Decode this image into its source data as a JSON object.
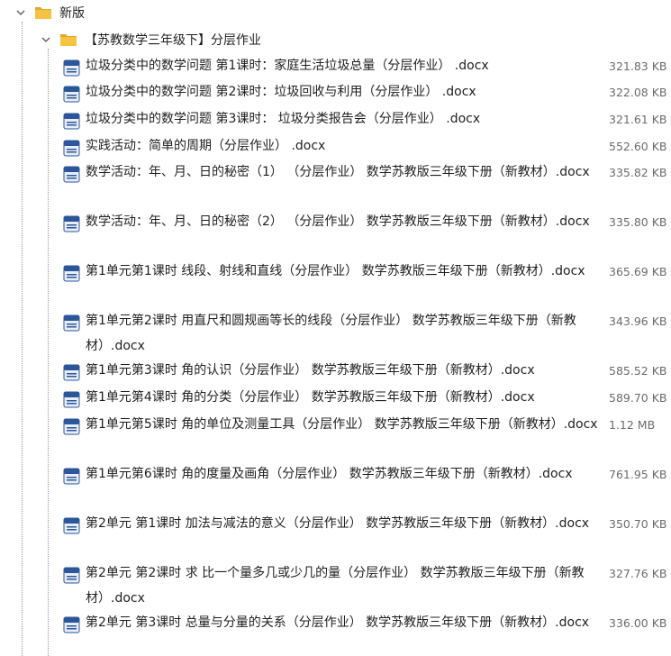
{
  "root_folder": {
    "name": "新版"
  },
  "sub_folder": {
    "name": "【苏教数学三年级下】分层作业"
  },
  "files": [
    {
      "name": "垃圾分类中的数学问题 第1课时：家庭生活垃圾总量（分层作业） .docx",
      "size": "321.83 KB"
    },
    {
      "name": "垃圾分类中的数学问题 第2课时：垃圾回收与利用（分层作业） .docx",
      "size": "322.08 KB"
    },
    {
      "name": "垃圾分类中的数学问题 第3课时： 垃圾分类报告会（分层作业） .docx",
      "size": "321.61 KB"
    },
    {
      "name": "实践活动：简单的周期（分层作业） .docx",
      "size": "552.60 KB"
    },
    {
      "name": "数学活动：年、月、日的秘密（1） （分层作业） 数学苏教版三年级下册（新教材）.docx",
      "size": "335.82 KB"
    },
    {
      "name": "数学活动：年、月、日的秘密（2） （分层作业） 数学苏教版三年级下册（新教材）.docx",
      "size": "335.80 KB"
    },
    {
      "name": "第1单元第1课时 线段、射线和直线（分层作业） 数学苏教版三年级下册（新教材）.docx",
      "size": "365.69 KB"
    },
    {
      "name": "第1单元第2课时 用直尺和圆规画等长的线段（分层作业） 数学苏教版三年级下册（新教材）.docx",
      "size": "343.96 KB"
    },
    {
      "name": "第1单元第3课时 角的认识（分层作业） 数学苏教版三年级下册（新教材）.docx",
      "size": "585.52 KB"
    },
    {
      "name": "第1单元第4课时 角的分类（分层作业） 数学苏教版三年级下册（新教材）.docx",
      "size": "589.70 KB"
    },
    {
      "name": "第1单元第5课时 角的单位及测量工具（分层作业） 数学苏教版三年级下册（新教材）.docx",
      "size": "1.12 MB"
    },
    {
      "name": "第1单元第6课时 角的度量及画角（分层作业） 数学苏教版三年级下册（新教材）.docx",
      "size": "761.95 KB"
    },
    {
      "name": "第2单元 第1课时 加法与减法的意义（分层作业） 数学苏教版三年级下册（新教材）.docx",
      "size": "350.70 KB"
    },
    {
      "name": "第2单元 第2课时 求 比一个量多几或少几的量（分层作业） 数学苏教版三年级下册（新教材）.docx",
      "size": "327.76 KB"
    },
    {
      "name": "第2单元 第3课时 总量与分量的关系（分层作业） 数学苏教版三年级下册（新教材）.docx",
      "size": "336.00 KB"
    }
  ],
  "colors": {
    "folder_yellow": "#f6c342",
    "folder_dark": "#e0a82e",
    "doc_blue": "#2b579a",
    "size_gray": "#6b6b6b"
  },
  "icons": {
    "expand": "chevron-down-icon",
    "folder": "folder-icon",
    "file": "word-document-icon"
  }
}
